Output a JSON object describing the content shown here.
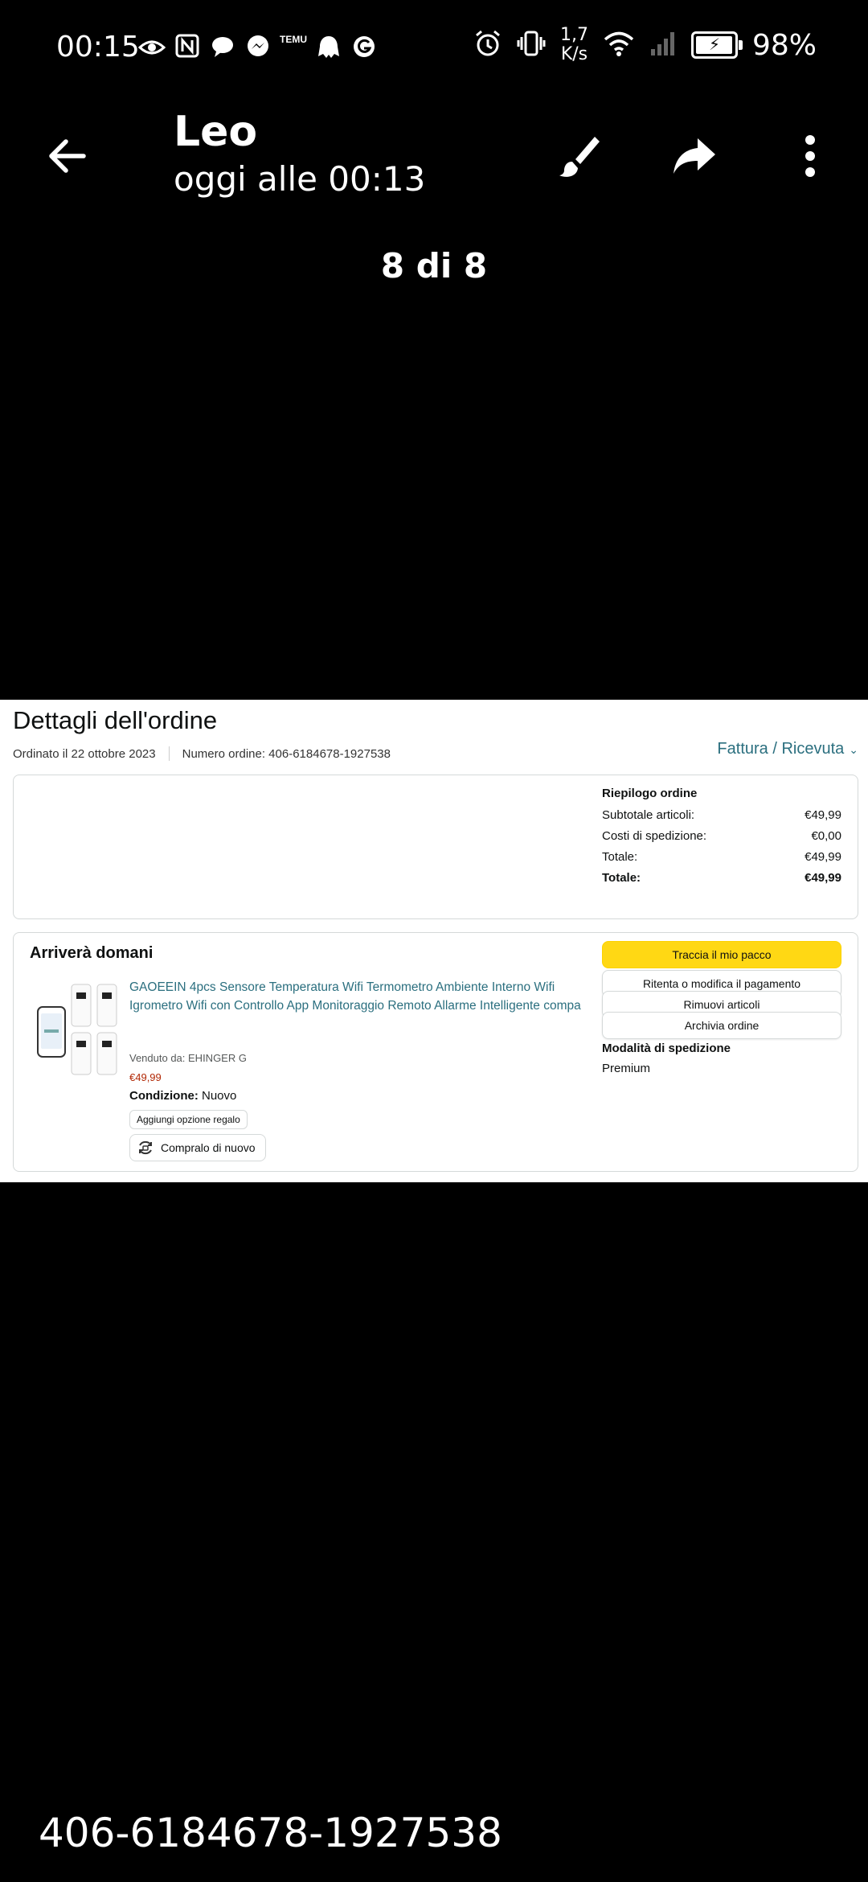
{
  "status_bar": {
    "time": "00:15",
    "left_icons": [
      "eye-icon",
      "nfc-icon",
      "chat-bubble-icon",
      "messenger-icon",
      "temu-icon",
      "ghost-icon",
      "g-icon"
    ],
    "temu_label": "TEMU",
    "network_speed_value": "1,7",
    "network_speed_unit": "K/s",
    "battery_percent": "98%"
  },
  "app_bar": {
    "title": "Leo",
    "subtitle": "oggi alle 00:13",
    "actions": [
      "brush-icon",
      "share-icon",
      "more-vert-icon"
    ]
  },
  "image_counter": "8 di 8",
  "order_screenshot": {
    "page_title": "Dettagli dell'ordine",
    "ordered_on": "Ordinato il 22 ottobre 2023",
    "order_number": "Numero ordine: 406-6184678-1927538",
    "invoice_link": "Fattura / Ricevuta",
    "summary": {
      "heading": "Riepilogo ordine",
      "rows": [
        {
          "label": "Subtotale articoli:",
          "value": "€49,99",
          "bold": false
        },
        {
          "label": "Costi di spedizione:",
          "value": "€0,00",
          "bold": false
        },
        {
          "label": "Totale:",
          "value": "€49,99",
          "bold": false
        },
        {
          "label": "Totale:",
          "value": "€49,99",
          "bold": true
        }
      ]
    },
    "shipment": {
      "heading": "Arriverà domani",
      "product_title": "GAOEEIN 4pcs Sensore Temperatura Wifi Termometro Ambiente Interno Wifi Igrometro Wifi con Controllo App Monitoraggio Remoto Allarme Intelligente compa",
      "seller": "Venduto da: EHINGER G",
      "price": "€49,99",
      "condition_label": "Condizione:",
      "condition_value": "Nuovo",
      "gift_button": "Aggiungi opzione regalo",
      "buy_again_button": "Compralo di nuovo",
      "actions": {
        "track": "Traccia il mio pacco",
        "retry_payment": "Ritenta o modifica il pagamento",
        "remove_items": "Rimuovi articoli",
        "archive": "Archivia ordine"
      },
      "shipping_heading": "Modalità di spedizione",
      "shipping_value": "Premium"
    }
  },
  "caption": "406-6184678-1927538",
  "colors": {
    "background": "#000000",
    "link": "#2b6f7f",
    "price": "#b12704",
    "primary_button": "#ffd814"
  }
}
